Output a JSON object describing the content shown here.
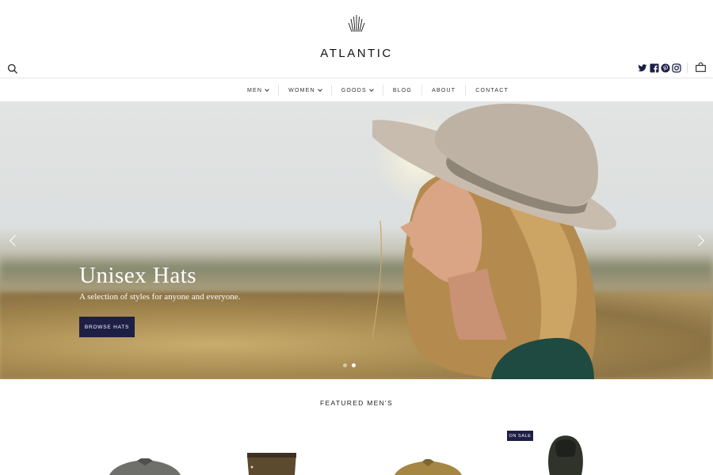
{
  "header": {
    "logo_text": "ATLANTIC",
    "icons": [
      "search-icon",
      "twitter-icon",
      "facebook-icon",
      "pinterest-icon",
      "instagram-icon",
      "shopping-bag-icon"
    ]
  },
  "nav": {
    "items": [
      {
        "label": "MEN",
        "dropdown": true
      },
      {
        "label": "WOMEN",
        "dropdown": true
      },
      {
        "label": "GOODS",
        "dropdown": true
      },
      {
        "label": "BLOG",
        "dropdown": false
      },
      {
        "label": "ABOUT",
        "dropdown": false
      },
      {
        "label": "CONTACT",
        "dropdown": false
      }
    ]
  },
  "hero": {
    "title": "Unisex Hats",
    "subtitle": "A selection of styles for anyone and everyone.",
    "button_label": "BROWSE HATS",
    "slide_count": 2,
    "active_slide": 1
  },
  "featured": {
    "title": "FEATURED MEN'S",
    "sale_badge": "ON SALE",
    "products": [
      "gray-shirt",
      "brown-trousers",
      "tan-jacket",
      "olive-hooded-jacket"
    ]
  },
  "colors": {
    "accent": "#1d1f45",
    "text": "#222222",
    "divider": "#e6e6e6"
  }
}
